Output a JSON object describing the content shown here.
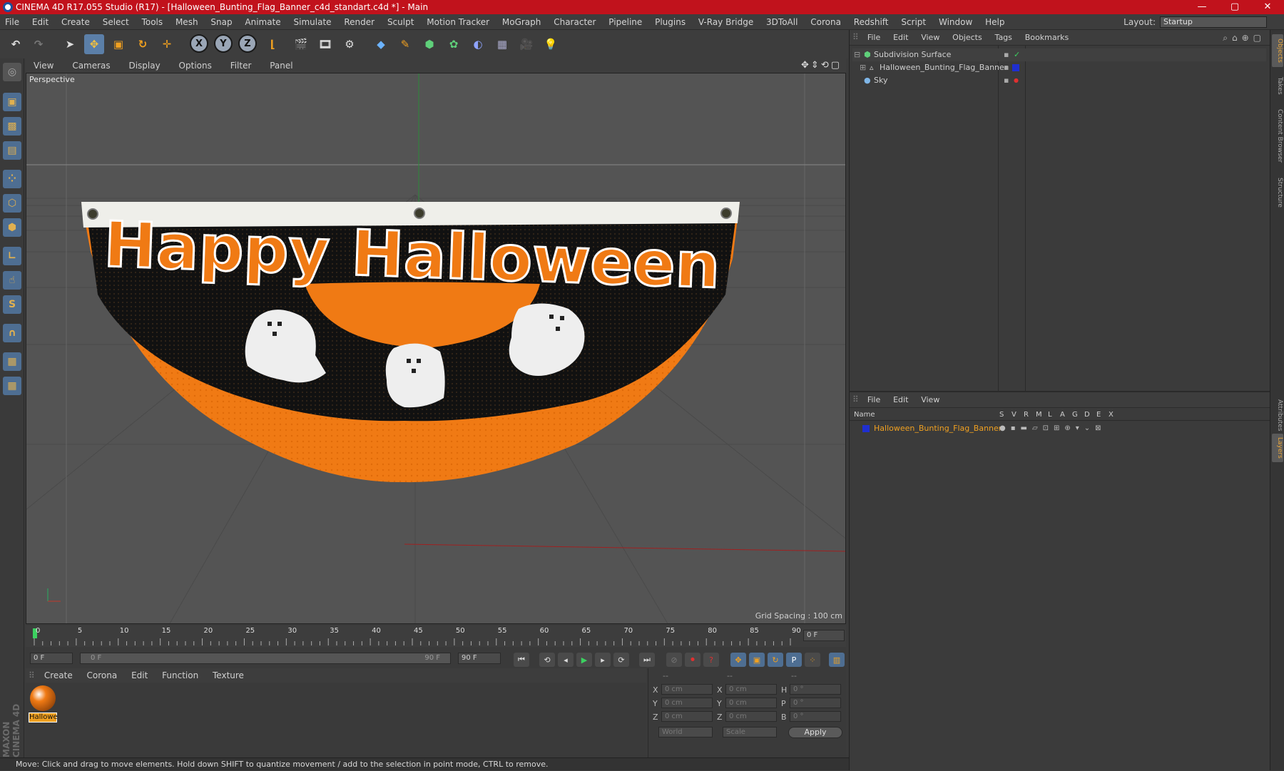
{
  "window": {
    "title": "CINEMA 4D R17.055 Studio (R17) - [Halloween_Bunting_Flag_Banner_c4d_standart.c4d *] - Main",
    "minimize": "—",
    "maximize": "▢",
    "close": "✕"
  },
  "menubar": {
    "items": [
      "File",
      "Edit",
      "Create",
      "Select",
      "Tools",
      "Mesh",
      "Snap",
      "Animate",
      "Simulate",
      "Render",
      "Sculpt",
      "Motion Tracker",
      "MoGraph",
      "Character",
      "Pipeline",
      "Plugins",
      "V-Ray Bridge",
      "3DToAll",
      "Corona",
      "Redshift",
      "Script",
      "Window",
      "Help"
    ],
    "layout_label": "Layout:",
    "layout_value": "Startup"
  },
  "toolbar": {
    "x_label": "X",
    "y_label": "Y",
    "z_label": "Z"
  },
  "viewport": {
    "menu": [
      "View",
      "Cameras",
      "Display",
      "Options",
      "Filter",
      "Panel"
    ],
    "camera_label": "Perspective",
    "grid_spacing": "Grid Spacing : 100 cm",
    "banner_text": "Happy Halloween",
    "accent_orange": "#f07a14",
    "axis_x_color": "#c0392b",
    "axis_y_color": "#27ae60"
  },
  "timeline": {
    "ticks": [
      "0",
      "5",
      "10",
      "15",
      "20",
      "25",
      "30",
      "35",
      "40",
      "45",
      "50",
      "55",
      "60",
      "65",
      "70",
      "75",
      "80",
      "85",
      "90"
    ],
    "current_frame": "0 F",
    "start_field": "0 F",
    "range_start": "0 F",
    "range_end": "90 F",
    "end_field": "90 F"
  },
  "material_manager": {
    "menu": [
      "Create",
      "Corona",
      "Edit",
      "Function",
      "Texture"
    ],
    "material_name": "Hallowe"
  },
  "coordinates": {
    "header": [
      "--",
      "--",
      "--"
    ],
    "rows": [
      {
        "a": "X",
        "av": "0 cm",
        "b": "X",
        "bv": "0 cm",
        "c": "H",
        "cv": "0 °"
      },
      {
        "a": "Y",
        "av": "0 cm",
        "b": "Y",
        "bv": "0 cm",
        "c": "P",
        "cv": "0 °"
      },
      {
        "a": "Z",
        "av": "0 cm",
        "b": "Z",
        "bv": "0 cm",
        "c": "B",
        "cv": "0 °"
      }
    ],
    "world": "World",
    "scale": "Scale",
    "apply": "Apply"
  },
  "status": {
    "text": "Move: Click and drag to move elements. Hold down SHIFT to quantize movement / add to the selection in point mode, CTRL to remove."
  },
  "object_manager": {
    "menu": [
      "File",
      "Edit",
      "View",
      "Objects",
      "Tags",
      "Bookmarks"
    ],
    "objects": [
      "Subdivision Surface",
      "Halloween_Bunting_Flag_Banner",
      "Sky"
    ]
  },
  "layer_manager": {
    "menu": [
      "File",
      "Edit",
      "View"
    ],
    "columns": [
      "Name",
      "S",
      "V",
      "R",
      "M",
      "L",
      "A",
      "G",
      "D",
      "E",
      "X"
    ],
    "layer_name": "Halloween_Bunting_Flag_Banner",
    "layer_color": "#1f2fd0"
  },
  "right_tabs": [
    "Objects",
    "Takes",
    "Content Browser",
    "Structure",
    "Attributes",
    "Layers"
  ],
  "brand": "MAXON CINEMA 4D"
}
